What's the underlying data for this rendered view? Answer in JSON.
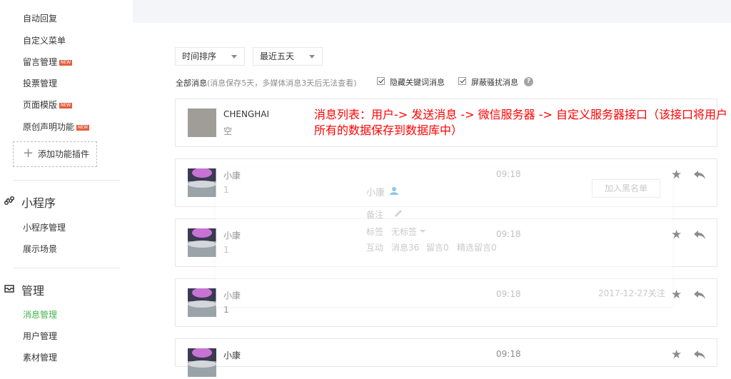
{
  "sidebar": {
    "items_top": [
      {
        "label": "自动回复",
        "new": false
      },
      {
        "label": "自定义菜单",
        "new": false
      },
      {
        "label": "留言管理",
        "new": true
      },
      {
        "label": "投票管理",
        "new": false
      },
      {
        "label": "页面模版",
        "new": true
      },
      {
        "label": "原创声明功能",
        "new": true
      }
    ],
    "new_badge": "NEW",
    "add_plugin": "添加功能插件",
    "sections": [
      {
        "title": "小程序",
        "icon": "miniprogram-icon",
        "items": [
          "小程序管理",
          "展示场景"
        ]
      },
      {
        "title": "管理",
        "icon": "inbox-icon",
        "items": [
          "消息管理",
          "用户管理",
          "素材管理"
        ]
      }
    ],
    "active_item": "消息管理",
    "accent": "#44b549"
  },
  "filters": {
    "sort_select": "时间排序",
    "range_select": "最近五天",
    "all_messages": "全部消息",
    "note": "(消息保存5天，多媒体消息3天后无法查看)",
    "hide_keyword": "隐藏关键词消息",
    "block_harass": "屏蔽骚扰消息",
    "help": "?"
  },
  "annotation": "消息列表：用户-> 发送消息 -> 微信服务器 -> 自定义服务器接口（该接口将用户所有的数据保存到数据库中）",
  "messages": [
    {
      "name": "CHENGHAI",
      "content": "空",
      "time": ""
    },
    {
      "name": "小康",
      "content": "1",
      "time": "09:18"
    },
    {
      "name": "小康",
      "content": "1",
      "time": "09:18"
    },
    {
      "name": "小康",
      "content": "1",
      "time": "09:18"
    },
    {
      "name": "小康",
      "content": "",
      "time": "09:18"
    }
  ],
  "popover": {
    "name": "小康",
    "blacklist_button": "加入黑名单",
    "remark_label": "备注",
    "tag_label": "标签",
    "tag_value": "无标签",
    "interaction_label": "互动",
    "messages_count": "消息36",
    "comments_count": "留言0",
    "featured_comments": "精选留言0",
    "followed": "2017-12-27关注"
  }
}
